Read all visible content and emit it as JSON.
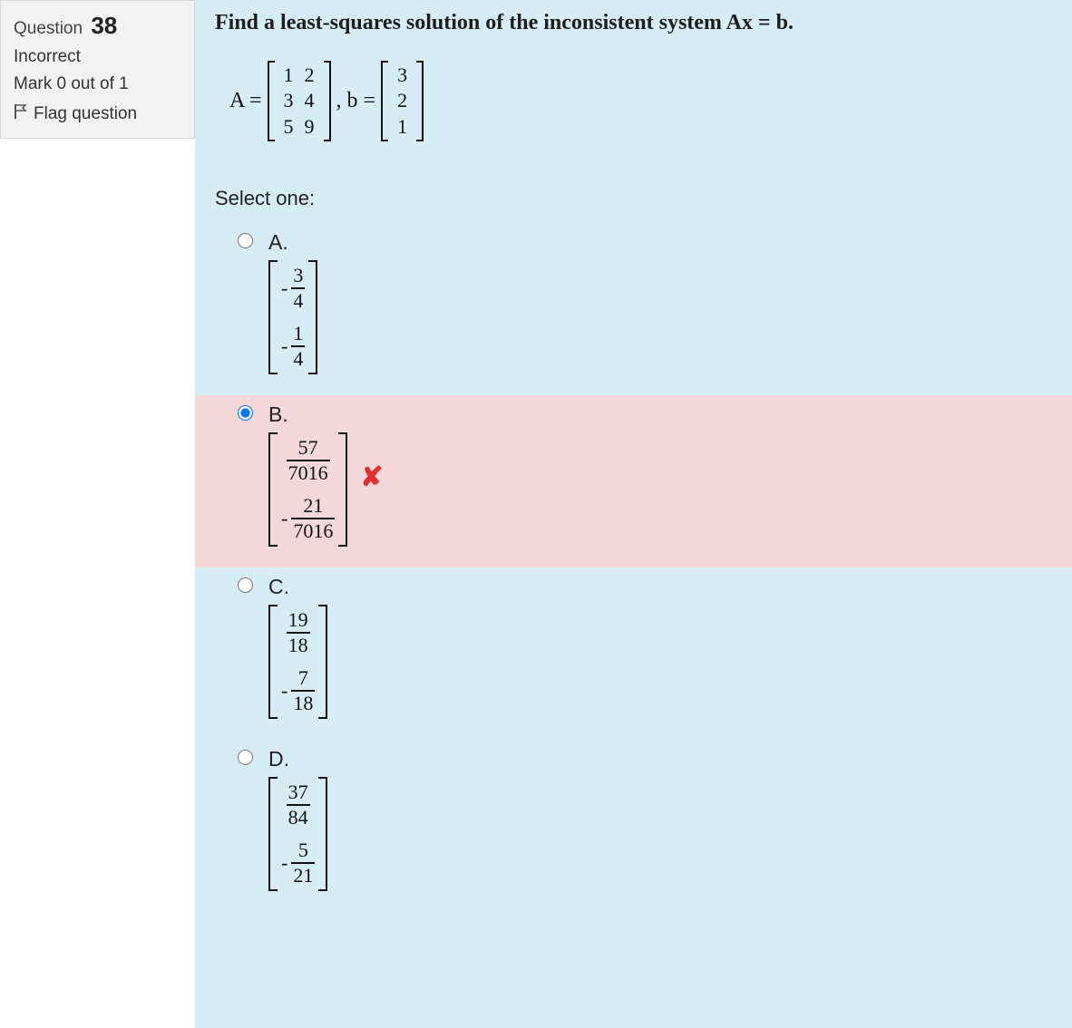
{
  "sidebar": {
    "question_label": "Question",
    "question_number": "38",
    "status": "Incorrect",
    "mark": "Mark 0 out of 1",
    "flag_label": "Flag question"
  },
  "question": {
    "prompt": "Find a least-squares solution of the inconsistent system Ax = b.",
    "A_label": "A =",
    "b_label": ", b =",
    "A": [
      [
        "1",
        "2"
      ],
      [
        "3",
        "4"
      ],
      [
        "5",
        "9"
      ]
    ],
    "b": [
      "3",
      "2",
      "1"
    ],
    "select_label": "Select one:"
  },
  "options": [
    {
      "letter": "A.",
      "selected": false,
      "incorrect": false,
      "entries": [
        {
          "neg": true,
          "num": "3",
          "den": "4"
        },
        {
          "neg": true,
          "num": "1",
          "den": "4"
        }
      ]
    },
    {
      "letter": "B.",
      "selected": true,
      "incorrect": true,
      "entries": [
        {
          "neg": false,
          "num": "57",
          "den": "7016"
        },
        {
          "neg": true,
          "num": "21",
          "den": "7016"
        }
      ]
    },
    {
      "letter": "C.",
      "selected": false,
      "incorrect": false,
      "entries": [
        {
          "neg": false,
          "num": "19",
          "den": "18"
        },
        {
          "neg": true,
          "num": "7",
          "den": "18"
        }
      ]
    },
    {
      "letter": "D.",
      "selected": false,
      "incorrect": false,
      "entries": [
        {
          "neg": false,
          "num": "37",
          "den": "84"
        },
        {
          "neg": true,
          "num": "5",
          "den": "21"
        }
      ]
    }
  ],
  "icons": {
    "x_mark": "✘"
  }
}
